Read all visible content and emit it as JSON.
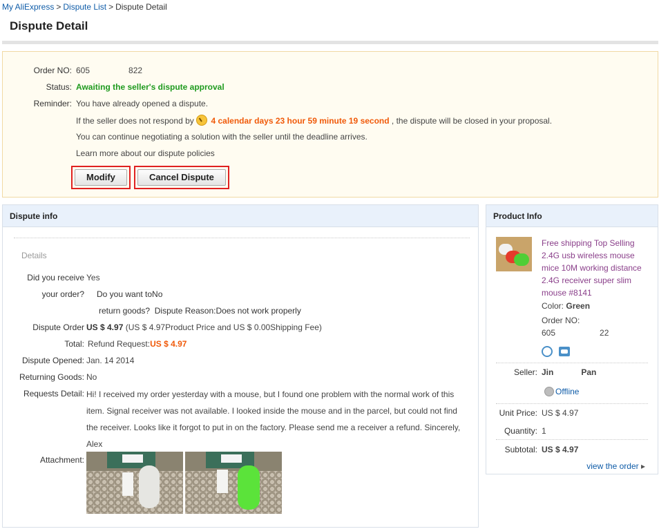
{
  "breadcrumb": {
    "home": "My AliExpress",
    "sep1": ">",
    "list": "Dispute List",
    "sep2": ">",
    "current": "Dispute Detail"
  },
  "page_title": "Dispute Detail",
  "status_box": {
    "order_no_label": "Order NO:",
    "order_no_part1": "605",
    "order_no_part2": "822",
    "status_label": "Status:",
    "status_value": "Awaiting the seller's dispute approval",
    "reminder_label": "Reminder:",
    "reminder_line1": "You have already opened a dispute.",
    "reminder_line2_pre": "If the seller does not respond by",
    "countdown": "4 calendar days 23 hour 59 minute 19 second",
    "reminder_line2_post": ", the dispute will be closed in your proposal.",
    "reminder_line3": "You can continue negotiating a solution with the seller until the deadline arrives.",
    "policy_link": "Learn more about our dispute policies",
    "modify_label": "Modify",
    "cancel_label": "Cancel Dispute",
    "accent_color": "#1e9a1e",
    "countdown_color": "#f05a0a"
  },
  "dispute_info": {
    "header": "Dispute info",
    "details_label": "Details",
    "received_label_1": "Did you receive",
    "received_label_2": "your order?",
    "received_value": "Yes",
    "return_label_1": "Do you want to",
    "return_label_2": "return goods?",
    "return_value": "No",
    "reason_label": "Dispute Reason:",
    "reason_value": "Does not work properly",
    "order_total_label_1": "Dispute Order",
    "order_total_label_2": "Total:",
    "order_total_value": "US $ 4.97",
    "order_total_breakdown": "(US $ 4.97Product Price and US $ 0.00Shipping Fee)",
    "refund_label": "Refund Request:",
    "refund_value": "US $ 4.97",
    "opened_label": "Dispute Opened:",
    "opened_value": "Jan. 14 2014",
    "returning_label": "Returning Goods:",
    "returning_value": "No",
    "request_label": "Requests Detail:",
    "request_value": "Hi! I received my order yesterday with a mouse, but I found one problem with the normal work of this item. Signal receiver was not available. I looked inside the mouse and in the parcel, but could not find the receiver. Looks like it forgot to put in on the factory. Please send me a receiver a refund. Sincerely, Alex",
    "attachment_label": "Attachment:"
  },
  "product_info": {
    "header": "Product Info",
    "title": "Free shipping Top Selling 2.4G usb wireless mouse mice 10M working distance 2.4G receiver super slim mouse #8141",
    "color_label": "Color:",
    "color_value": "Green",
    "order_no_label": "Order NO:",
    "order_no_part1": "605",
    "order_no_part2": "22",
    "seller_label": "Seller:",
    "seller_first": "Jin",
    "seller_last": "Pan",
    "seller_status": "Offline",
    "unit_price_label": "Unit Price:",
    "unit_price_value": "US $ 4.97",
    "quantity_label": "Quantity:",
    "quantity_value": "1",
    "subtotal_label": "Subtotal:",
    "subtotal_value": "US $ 4.97",
    "view_order_link": "view the order",
    "view_order_arrow": "▸"
  }
}
